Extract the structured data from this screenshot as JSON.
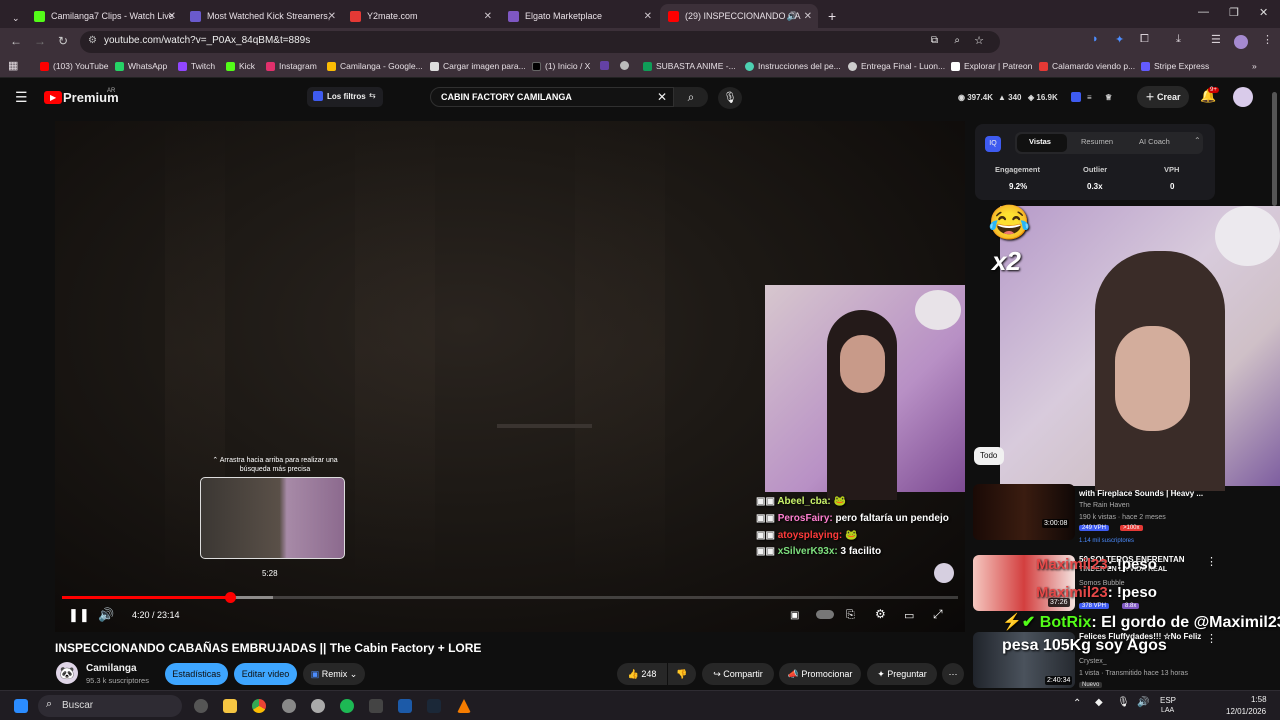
{
  "browser": {
    "tabs": [
      {
        "label": "Camilanga7 Clips - Watch Live",
        "fav": "#53fc18"
      },
      {
        "label": "Most Watched Kick Streamers,",
        "fav": "#6a5acd"
      },
      {
        "label": "Y2mate.com",
        "fav": "#e53935"
      },
      {
        "label": "Elgato Marketplace",
        "fav": "#7e57c2"
      },
      {
        "label": "(29) INSPECCIONANDO CA",
        "fav": "#ff0000"
      }
    ],
    "url": "youtube.com/watch?v=_P0Ax_84qBM&t=889s",
    "bookmarks": [
      {
        "label": "(103) YouTube",
        "color": "#ff0000"
      },
      {
        "label": "WhatsApp",
        "color": "#25d366"
      },
      {
        "label": "Twitch",
        "color": "#9146ff"
      },
      {
        "label": "Kick",
        "color": "#53fc18"
      },
      {
        "label": "Instagram",
        "color": "#e1306c"
      },
      {
        "label": "Camilanga - Google...",
        "color": "#fbbc04"
      },
      {
        "label": "Cargar imagen para...",
        "color": "#dddddd"
      },
      {
        "label": "(1) Inicio / X",
        "color": "#000000"
      },
      {
        "label": "",
        "color": "#6441a5"
      },
      {
        "label": "",
        "color": "#bbbbbb"
      },
      {
        "label": "SUBASTA ANIME -...",
        "color": "#0f9d58"
      },
      {
        "label": "Instrucciones del pe...",
        "color": "#4dd0b1"
      },
      {
        "label": "Entrega Final - Luon...",
        "color": "#cccccc"
      },
      {
        "label": "Explorar | Patreon",
        "color": "#ffffff"
      },
      {
        "label": "Calamardo viendo p...",
        "color": "#e53935"
      },
      {
        "label": "Stripe Express",
        "color": "#635bff"
      }
    ]
  },
  "yt": {
    "logo": "Premium",
    "logo_sup": "AR",
    "filters": "Los filtros",
    "search_value": "CABIN FACTORY CAMILANGA",
    "stats": [
      "397.4K",
      "340",
      "16.9K"
    ],
    "create": "Crear",
    "notif": "9+"
  },
  "player": {
    "tooltip": "Arrastra hacia arriba para realizar una búsqueda más precisa",
    "thumb_time": "5:28",
    "time": "4:20 / 23:14",
    "progress_fraction": 0.187,
    "buffer_fraction": 0.236,
    "chat": [
      {
        "user": "Abeel_cba:",
        "msg": "",
        "color": "#c9f26b"
      },
      {
        "user": "PerosFairy:",
        "msg": "pero faltaría un pendejo",
        "color": "#ff7fd0"
      },
      {
        "user": "atoysplaying:",
        "msg": "",
        "color": "#ff3b3b"
      },
      {
        "user": "xSilverK93x:",
        "msg": "3 facilito",
        "color": "#7ee07e"
      }
    ]
  },
  "video": {
    "title": "INSPECCIONANDO CABAÑAS EMBRUJADAS || The Cabin Factory + LORE",
    "channel": "Camilanga",
    "subs": "95.3 k suscriptores",
    "btn_stats": "Estadísticas",
    "btn_edit": "Editar video",
    "btn_remix": "Remix",
    "likes": "248",
    "share": "Compartir",
    "promote": "Promocionar",
    "ask": "Preguntar"
  },
  "vidiq": {
    "tabs": [
      "Vistas",
      "Resumen",
      "AI Coach"
    ],
    "labels": [
      "Engagement",
      "Outlier",
      "VPH"
    ],
    "values": [
      "9.2%",
      "0.3x",
      "0"
    ]
  },
  "side": {
    "chip": "Todo",
    "overlay_x2": "x2",
    "videos": [
      {
        "title": "with Fireplace Sounds | Heavy ...",
        "channel": "The Rain Haven",
        "meta": "190 k vistas · hace 2 meses",
        "vph": "249 VPH",
        "badge": ">100x",
        "extra": "1.14 mil suscriptores",
        "dur": "3:00:08"
      },
      {
        "title": "50 SOLTEROS ENFRENTAN",
        "title2": "TINDER EN LA VIDA REAL",
        "channel": "Somos Bubble",
        "meta": "",
        "vph": "378 VPH",
        "badge": "8.8x",
        "extra": "",
        "dur": "37:26"
      },
      {
        "title": "Felices Fluffydades!!! ☆No Feliz",
        "channel": "Crystex_",
        "meta": "1 vista · Transmitido hace 13 horas",
        "vph": "",
        "badge": "",
        "extra": "Nuevo",
        "dur": "2:40:34"
      }
    ],
    "overlay_chat": [
      {
        "user": "Maximil23",
        "msg": ": !peso"
      },
      {
        "user": "Maximil23",
        "msg": ": !peso"
      },
      {
        "user": "BotRix",
        "msg": ": El gordo de @Maximil23"
      },
      {
        "user": "",
        "msg": "pesa 105Kg soy Agos"
      }
    ]
  },
  "taskbar": {
    "search": "Buscar",
    "lang": "ESP",
    "lang2": "LAA",
    "time": "1:58",
    "date": "12/01/2026"
  }
}
